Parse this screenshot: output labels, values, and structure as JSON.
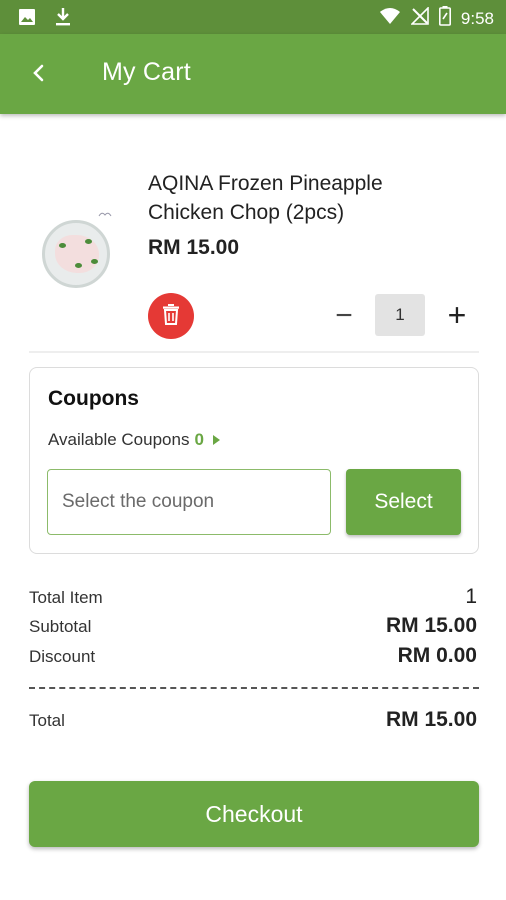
{
  "status_bar": {
    "time": "9:58",
    "icons": [
      "image-icon",
      "download-icon",
      "wifi-icon",
      "no-signal-icon",
      "battery-icon"
    ]
  },
  "header": {
    "title": "My Cart",
    "back_icon": "chevron-left-icon"
  },
  "cart_item": {
    "name_line1": "AQINA Frozen Pineapple",
    "name_line2": "Chicken Chop (2pcs)",
    "price": "RM 15.00",
    "quantity": "1",
    "minus_label": "−",
    "plus_label": "+",
    "delete_icon": "trash-icon"
  },
  "coupons": {
    "title": "Coupons",
    "available_label": "Available Coupons",
    "available_count": "0",
    "input_placeholder": "Select the coupon",
    "select_label": "Select"
  },
  "summary": {
    "total_item_label": "Total Item",
    "total_item_value": "1",
    "subtotal_label": "Subtotal",
    "subtotal_value": "RM 15.00",
    "discount_label": "Discount",
    "discount_value": "RM 0.00",
    "total_label": "Total",
    "total_value": "RM 15.00"
  },
  "checkout": {
    "label": "Checkout"
  },
  "colors": {
    "primary": "#6aa744",
    "status_bar": "#5e8f3a",
    "danger": "#e53935"
  }
}
